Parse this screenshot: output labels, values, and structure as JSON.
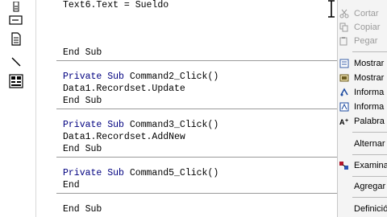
{
  "editor": {
    "lines": [
      {
        "text": "Text6.Text = Sueldo"
      },
      {
        "text": "End Sub"
      },
      {
        "kw": "Private Sub",
        "rest": " Command2_Click()"
      },
      {
        "text": "Data1.Recordset.Update"
      },
      {
        "text": "End Sub"
      },
      {
        "kw": "Private Sub",
        "rest": " Command3_Click()"
      },
      {
        "text": "Data1.Recordset.AddNew"
      },
      {
        "text": "End Sub"
      },
      {
        "kw": "Private Sub",
        "rest": " Command5_Click()"
      },
      {
        "text": "End"
      },
      {
        "text": "End Sub"
      }
    ]
  },
  "context_menu": {
    "items": [
      {
        "label": "Cortar",
        "icon": "scissors-icon",
        "enabled": false
      },
      {
        "label": "Copiar",
        "icon": "copy-icon",
        "enabled": false
      },
      {
        "label": "Pegar",
        "icon": "paste-icon",
        "enabled": false
      },
      {
        "label": "Mostrar",
        "icon": "list-properties-icon",
        "enabled": true
      },
      {
        "label": "Mostrar",
        "icon": "list-constants-icon",
        "enabled": true
      },
      {
        "label": "Informa",
        "icon": "quick-info-icon",
        "enabled": true
      },
      {
        "label": "Informa",
        "icon": "parameter-info-icon",
        "enabled": true
      },
      {
        "label": "Palabra",
        "icon": "complete-word-icon",
        "enabled": true
      },
      {
        "label": "Alternar",
        "icon": "",
        "enabled": true
      },
      {
        "label": "Examina",
        "icon": "object-browser-icon",
        "enabled": true
      },
      {
        "label": "Agregar",
        "icon": "",
        "enabled": true
      },
      {
        "label": "Definició",
        "icon": "",
        "enabled": true
      }
    ]
  },
  "toolbox": {
    "tools": [
      "scroll-icon",
      "textbox-icon",
      "frame-icon",
      "document-icon",
      "line-icon",
      "grid-icon"
    ]
  },
  "colors": {
    "keyword": "#000080",
    "menu_bg": "#f4f4f4",
    "disabled_text": "#9b9b9b"
  }
}
